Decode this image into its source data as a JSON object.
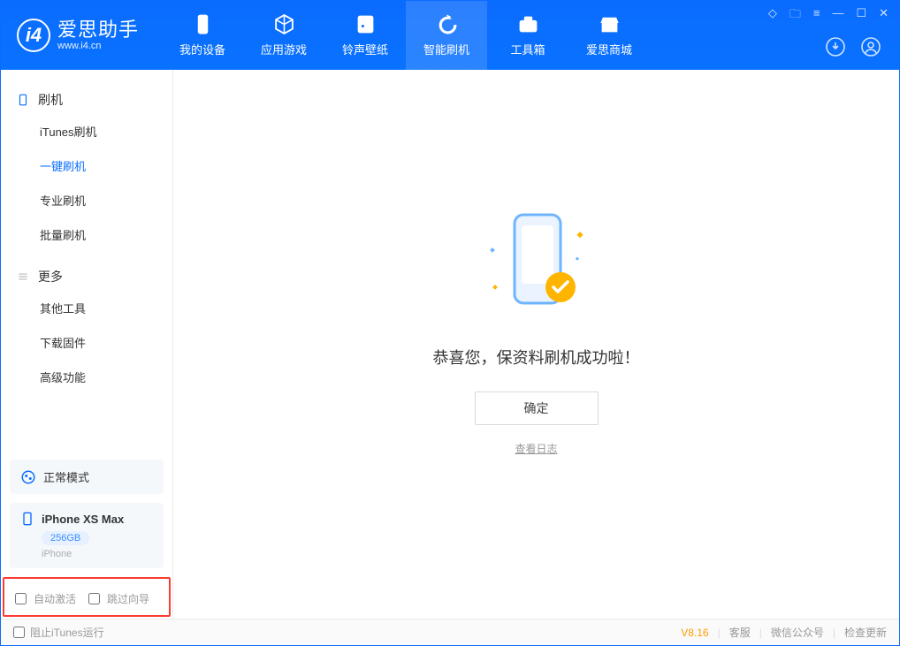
{
  "app": {
    "name": "爱思助手",
    "url": "www.i4.cn"
  },
  "nav": [
    {
      "label": "我的设备",
      "icon": "device"
    },
    {
      "label": "应用游戏",
      "icon": "cube"
    },
    {
      "label": "铃声壁纸",
      "icon": "music"
    },
    {
      "label": "智能刷机",
      "icon": "refresh"
    },
    {
      "label": "工具箱",
      "icon": "toolbox"
    },
    {
      "label": "爱思商城",
      "icon": "store"
    }
  ],
  "sidebar": {
    "section1": {
      "title": "刷机",
      "items": [
        "iTunes刷机",
        "一键刷机",
        "专业刷机",
        "批量刷机"
      ]
    },
    "section2": {
      "title": "更多",
      "items": [
        "其他工具",
        "下载固件",
        "高级功能"
      ]
    },
    "mode": "正常模式",
    "device": {
      "name": "iPhone XS Max",
      "capacity": "256GB",
      "type": "iPhone"
    },
    "options": {
      "auto_activate": "自动激活",
      "skip_guide": "跳过向导"
    }
  },
  "main": {
    "success_msg": "恭喜您，保资料刷机成功啦！",
    "confirm": "确定",
    "view_log": "查看日志"
  },
  "footer": {
    "block_itunes": "阻止iTunes运行",
    "version": "V8.16",
    "links": [
      "客服",
      "微信公众号",
      "检查更新"
    ]
  }
}
